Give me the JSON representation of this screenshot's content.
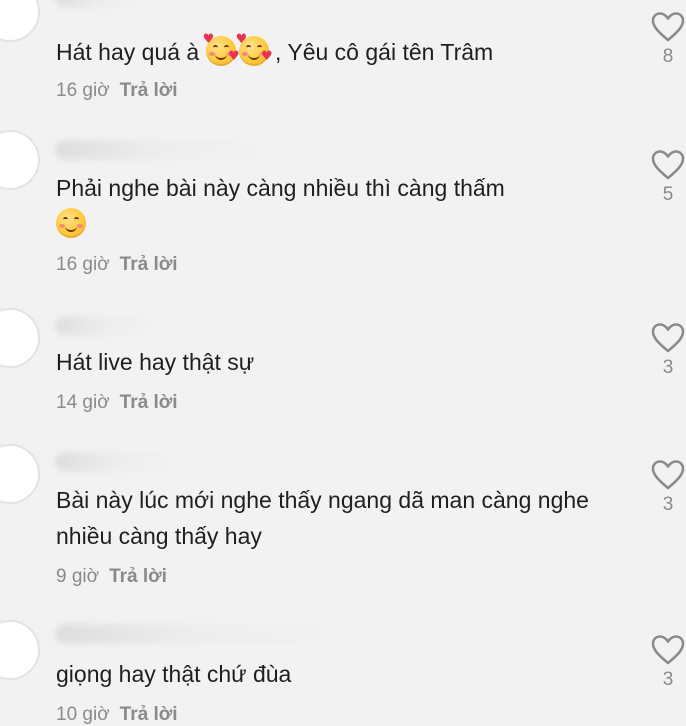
{
  "comments": [
    {
      "text_before_emoji": "Hát hay quá à ",
      "emojis": [
        "smiling-face-with-hearts-icon",
        "smiling-face-with-hearts-icon"
      ],
      "text_after_emoji": " , Yêu cô gái tên Trâm",
      "time": "16 giờ",
      "reply_label": "Trả lời",
      "like_count": "8"
    },
    {
      "text": "Phải nghe bài này càng nhiều thì càng thấm",
      "emojis": [
        "smiling-face-icon"
      ],
      "time": "16 giờ",
      "reply_label": "Trả lời",
      "like_count": "5"
    },
    {
      "text": "Hát live hay thật sự",
      "time": "14 giờ",
      "reply_label": "Trả lời",
      "like_count": "3"
    },
    {
      "text": "Bài này lúc mới nghe thấy ngang dã man càng nghe nhiều càng thấy hay",
      "time": "9 giờ",
      "reply_label": "Trả lời",
      "like_count": "3"
    },
    {
      "text": "giọng hay thật chứ đùa",
      "time": "10 giờ",
      "reply_label": "Trả lời",
      "like_count": "3"
    }
  ],
  "colors": {
    "background": "#f2f2f2",
    "text": "#1f1f1f",
    "meta": "#8a8a8a",
    "heart_outline": "#8a8a8a"
  },
  "icons": {
    "like": "heart-outline-icon"
  }
}
